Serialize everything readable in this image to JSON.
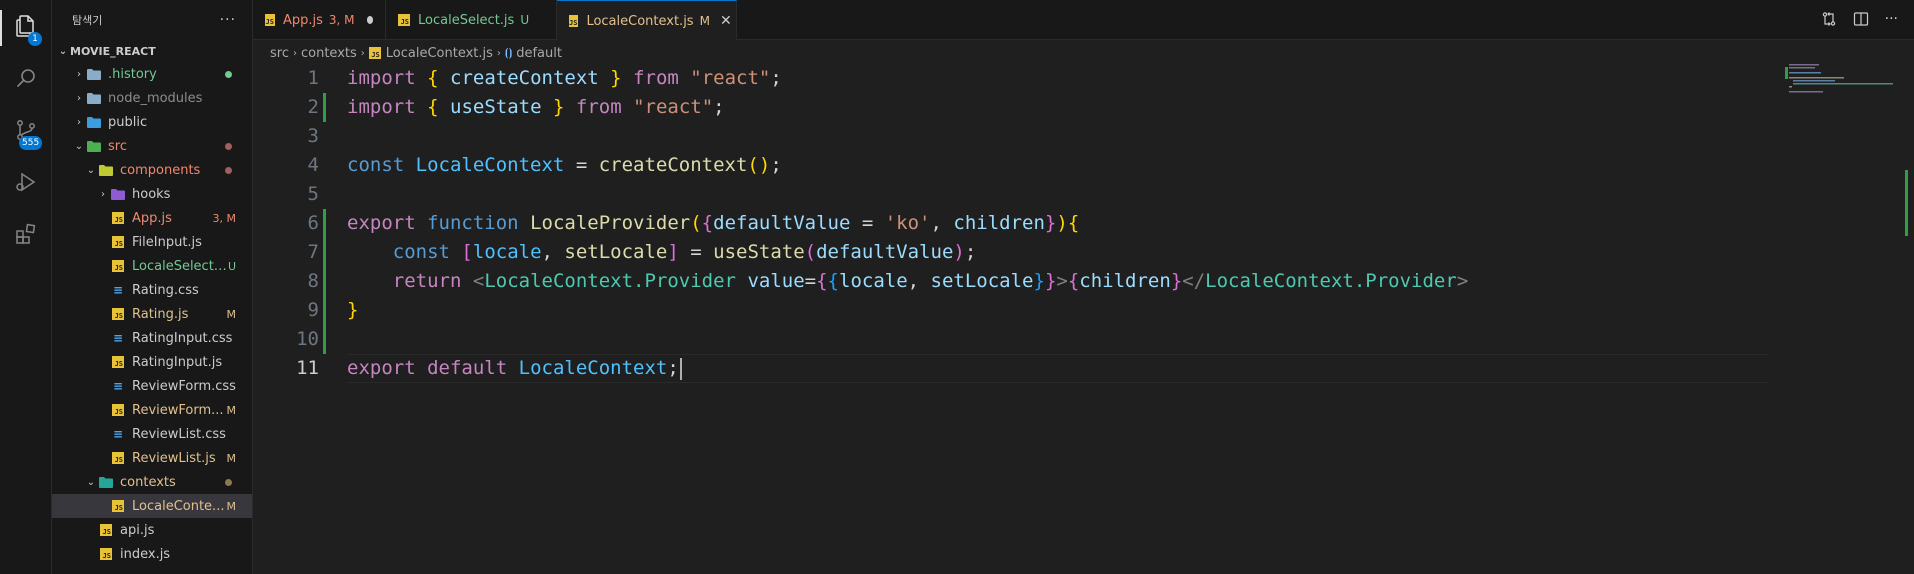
{
  "colors": {
    "modified": "#e2c08d",
    "untracked": "#73c991",
    "deleted_marker": "#a55e5e",
    "accent": "#0078d4",
    "gutter_added": "#2ea043",
    "folder_src": "#ef8870",
    "folder_history": "#8aacc8"
  },
  "activity_bar": {
    "items": [
      {
        "icon": "files-icon",
        "badge": "1"
      },
      {
        "icon": "search-icon",
        "badge": ""
      },
      {
        "icon": "source-control-icon",
        "badge": "555"
      },
      {
        "icon": "run-debug-icon",
        "badge": ""
      },
      {
        "icon": "extensions-icon",
        "badge": ""
      }
    ]
  },
  "explorer": {
    "title": "탐색기",
    "more": "···",
    "root": "MOVIE_REACT",
    "rows": [
      {
        "name": ".history",
        "depth": 1,
        "kind": "folder",
        "chev": "›",
        "status": "",
        "marker": "green",
        "color": "#73c991",
        "icon_color": "#8aacc8"
      },
      {
        "name": "node_modules",
        "depth": 1,
        "kind": "folder",
        "chev": "›",
        "status": "",
        "marker": "",
        "color": "#8c8c8c",
        "icon_color": "#8aacc8"
      },
      {
        "name": "public",
        "depth": 1,
        "kind": "folder",
        "chev": "›",
        "status": "",
        "marker": "",
        "color": "#cccccc",
        "icon_color": "#3b9ddd"
      },
      {
        "name": "src",
        "depth": 1,
        "kind": "folder",
        "chev": "⌄",
        "status": "",
        "marker": "red",
        "color": "#ef8870",
        "icon_color": "#4caf50"
      },
      {
        "name": "components",
        "depth": 2,
        "kind": "folder",
        "chev": "⌄",
        "status": "",
        "marker": "red",
        "color": "#ef8870",
        "icon_color": "#c0ca33"
      },
      {
        "name": "hooks",
        "depth": 3,
        "kind": "folder",
        "chev": "›",
        "status": "",
        "marker": "",
        "color": "#cccccc",
        "icon_color": "#8e5bd1"
      },
      {
        "name": "App.js",
        "depth": 3,
        "kind": "js",
        "chev": "",
        "status": "3, M",
        "marker": "",
        "color": "#ef8870"
      },
      {
        "name": "FileInput.js",
        "depth": 3,
        "kind": "js",
        "chev": "",
        "status": "",
        "marker": "",
        "color": "#cccccc"
      },
      {
        "name": "LocaleSelect.js",
        "depth": 3,
        "kind": "js",
        "chev": "",
        "status": "U",
        "marker": "",
        "color": "#73c991"
      },
      {
        "name": "Rating.css",
        "depth": 3,
        "kind": "css",
        "chev": "",
        "status": "",
        "marker": "",
        "color": "#cccccc"
      },
      {
        "name": "Rating.js",
        "depth": 3,
        "kind": "js",
        "chev": "",
        "status": "M",
        "marker": "",
        "color": "#e2c08d"
      },
      {
        "name": "RatingInput.css",
        "depth": 3,
        "kind": "css",
        "chev": "",
        "status": "",
        "marker": "",
        "color": "#cccccc"
      },
      {
        "name": "RatingInput.js",
        "depth": 3,
        "kind": "js",
        "chev": "",
        "status": "",
        "marker": "",
        "color": "#cccccc"
      },
      {
        "name": "ReviewForm.css",
        "depth": 3,
        "kind": "css",
        "chev": "",
        "status": "",
        "marker": "",
        "color": "#cccccc"
      },
      {
        "name": "ReviewForm...",
        "depth": 3,
        "kind": "js",
        "chev": "",
        "status": "M",
        "marker": "",
        "color": "#e2c08d"
      },
      {
        "name": "ReviewList.css",
        "depth": 3,
        "kind": "css",
        "chev": "",
        "status": "",
        "marker": "",
        "color": "#cccccc"
      },
      {
        "name": "ReviewList.js",
        "depth": 3,
        "kind": "js",
        "chev": "",
        "status": "M",
        "marker": "",
        "color": "#e2c08d"
      },
      {
        "name": "contexts",
        "depth": 2,
        "kind": "folder",
        "chev": "⌄",
        "status": "",
        "marker": "olive",
        "color": "#e2c08d",
        "icon_color": "#26a69a"
      },
      {
        "name": "LocaleConte...",
        "depth": 3,
        "kind": "js",
        "chev": "",
        "status": "M",
        "marker": "",
        "color": "#e2c08d",
        "selected": true
      },
      {
        "name": "api.js",
        "depth": 2,
        "kind": "js",
        "chev": "",
        "status": "",
        "marker": "",
        "color": "#cccccc"
      },
      {
        "name": "index.js",
        "depth": 2,
        "kind": "js",
        "chev": "",
        "status": "",
        "marker": "",
        "color": "#cccccc"
      }
    ]
  },
  "tabs": [
    {
      "label": "App.js",
      "status": "3, M",
      "color": "#ef8870",
      "active": false,
      "dirty": true
    },
    {
      "label": "LocaleSelect.js",
      "status": "U",
      "color": "#73c991",
      "active": false,
      "dirty": false
    },
    {
      "label": "LocaleContext.js",
      "status": "M",
      "color": "#e2c08d",
      "active": true,
      "dirty": false
    }
  ],
  "tab_actions": [
    "compare-changes-icon",
    "split-editor-icon",
    "more-actions-icon"
  ],
  "breadcrumb": [
    "src",
    "contexts",
    "LocaleContext.js",
    "default"
  ],
  "editor": {
    "current_line": 11,
    "lines": [
      {
        "n": "1",
        "added": false,
        "tokens": [
          [
            "import",
            "kw2"
          ],
          [
            " ",
            "pl"
          ],
          [
            "{",
            "b1"
          ],
          [
            " ",
            "pl"
          ],
          [
            "createContext",
            "var"
          ],
          [
            " ",
            "pl"
          ],
          [
            "}",
            "b1"
          ],
          [
            " ",
            "pl"
          ],
          [
            "from",
            "kw2"
          ],
          [
            " ",
            "pl"
          ],
          [
            "\"react\"",
            "str"
          ],
          [
            ";",
            "pl"
          ]
        ]
      },
      {
        "n": "2",
        "added": true,
        "tokens": [
          [
            "import",
            "kw2"
          ],
          [
            " ",
            "pl"
          ],
          [
            "{",
            "b1"
          ],
          [
            " ",
            "pl"
          ],
          [
            "useState",
            "var"
          ],
          [
            " ",
            "pl"
          ],
          [
            "}",
            "b1"
          ],
          [
            " ",
            "pl"
          ],
          [
            "from",
            "kw2"
          ],
          [
            " ",
            "pl"
          ],
          [
            "\"react\"",
            "str"
          ],
          [
            ";",
            "pl"
          ]
        ]
      },
      {
        "n": "3",
        "added": false,
        "tokens": []
      },
      {
        "n": "4",
        "added": false,
        "tokens": [
          [
            "const",
            "kw"
          ],
          [
            " ",
            "pl"
          ],
          [
            "LocaleContext",
            "cst"
          ],
          [
            " = ",
            "pl"
          ],
          [
            "createContext",
            "fn"
          ],
          [
            "()",
            "b1"
          ],
          [
            ";",
            "pl"
          ]
        ]
      },
      {
        "n": "5",
        "added": false,
        "tokens": []
      },
      {
        "n": "6",
        "added": true,
        "tokens": [
          [
            "export",
            "kw2"
          ],
          [
            " ",
            "pl"
          ],
          [
            "function",
            "kw"
          ],
          [
            " ",
            "pl"
          ],
          [
            "LocaleProvider",
            "fn"
          ],
          [
            "(",
            "b1"
          ],
          [
            "{",
            "b2"
          ],
          [
            "defaultValue",
            "var"
          ],
          [
            " = ",
            "pl"
          ],
          [
            "'ko'",
            "str"
          ],
          [
            ", ",
            "pl"
          ],
          [
            "children",
            "var"
          ],
          [
            "}",
            "b2"
          ],
          [
            ")",
            "b1"
          ],
          [
            "{",
            "b1"
          ]
        ]
      },
      {
        "n": "7",
        "added": true,
        "tokens": [
          [
            "    ",
            "pl"
          ],
          [
            "const",
            "kw"
          ],
          [
            " ",
            "pl"
          ],
          [
            "[",
            "b2"
          ],
          [
            "locale",
            "cst"
          ],
          [
            ", ",
            "pl"
          ],
          [
            "setLocale",
            "fn"
          ],
          [
            "]",
            "b2"
          ],
          [
            " = ",
            "pl"
          ],
          [
            "useState",
            "fn"
          ],
          [
            "(",
            "b2"
          ],
          [
            "defaultValue",
            "var"
          ],
          [
            ")",
            "b2"
          ],
          [
            ";",
            "pl"
          ]
        ]
      },
      {
        "n": "8",
        "added": true,
        "tokens": [
          [
            "    ",
            "pl"
          ],
          [
            "return",
            "kw2"
          ],
          [
            " ",
            "pl"
          ],
          [
            "<",
            "punc"
          ],
          [
            "LocaleContext.Provider",
            "tag"
          ],
          [
            " ",
            "pl"
          ],
          [
            "value",
            "var"
          ],
          [
            "=",
            "pl"
          ],
          [
            "{",
            "b2"
          ],
          [
            "{",
            "b3"
          ],
          [
            "locale",
            "var"
          ],
          [
            ", ",
            "pl"
          ],
          [
            "setLocale",
            "var"
          ],
          [
            "}",
            "b3"
          ],
          [
            "}",
            "b2"
          ],
          [
            ">",
            "punc"
          ],
          [
            "{",
            "b2"
          ],
          [
            "children",
            "var"
          ],
          [
            "}",
            "b2"
          ],
          [
            "</",
            "punc"
          ],
          [
            "LocaleContext.Provider",
            "tag"
          ],
          [
            ">",
            "punc"
          ]
        ]
      },
      {
        "n": "9",
        "added": true,
        "tokens": [
          [
            "}",
            "b1"
          ]
        ]
      },
      {
        "n": "10",
        "added": true,
        "tokens": []
      },
      {
        "n": "11",
        "added": false,
        "tokens": [
          [
            "export",
            "kw2"
          ],
          [
            " ",
            "pl"
          ],
          [
            "default",
            "kw2"
          ],
          [
            " ",
            "pl"
          ],
          [
            "LocaleContext",
            "cst"
          ],
          [
            ";",
            "pl"
          ]
        ]
      }
    ]
  }
}
